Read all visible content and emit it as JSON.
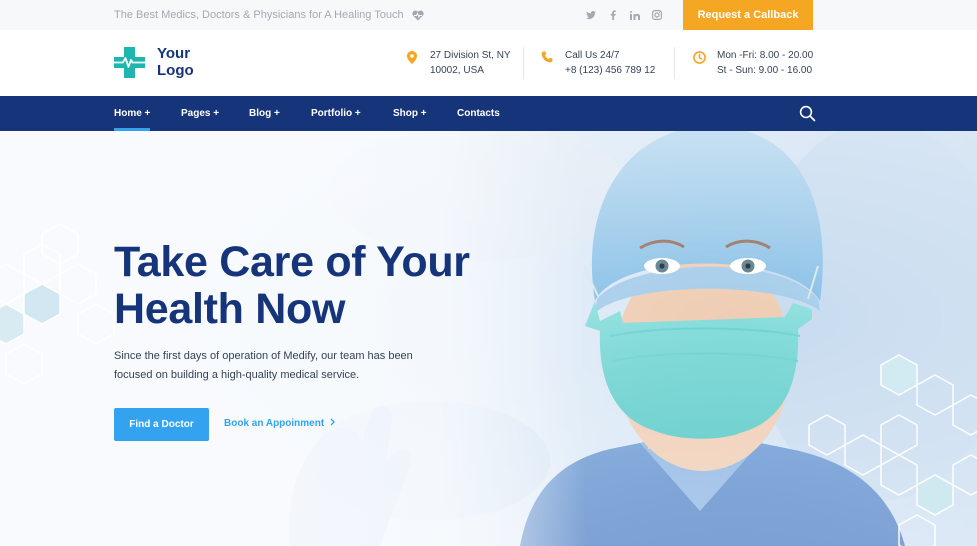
{
  "topbar": {
    "tagline": "The Best Medics, Doctors & Physicians for A Healing Touch",
    "tagline_icon": "heart-pulse-icon",
    "socials": [
      {
        "name": "twitter-icon",
        "glyph": "t"
      },
      {
        "name": "facebook-icon",
        "glyph": "f"
      },
      {
        "name": "linkedin-icon",
        "glyph": "in"
      },
      {
        "name": "instagram-icon",
        "glyph": "◎"
      }
    ],
    "callback_label": "Request a Callback"
  },
  "header": {
    "logo_line1": "Your",
    "logo_line2": "Logo",
    "address": {
      "icon": "location-pin-icon",
      "line1": "27 Division St, NY",
      "line2": "10002, USA"
    },
    "phone": {
      "icon": "phone-icon",
      "line1": "Call Us 24/7",
      "line2": "+8 (123) 456 789 12"
    },
    "hours": {
      "icon": "clock-icon",
      "line1": "Mon -Fri: 8.00 - 20.00",
      "line2": "St - Sun: 9.00 - 16.00"
    }
  },
  "nav": {
    "items": [
      {
        "label": "Home +",
        "active": true
      },
      {
        "label": "Pages +"
      },
      {
        "label": "Blog +"
      },
      {
        "label": "Portfolio +"
      },
      {
        "label": "Shop +"
      },
      {
        "label": "Contacts"
      }
    ],
    "search_icon": "search-icon"
  },
  "hero": {
    "title_line1": "Take Care of Your",
    "title_line2": "Health Now",
    "text_line1": "Since the first days of operation of Medify, our team has been",
    "text_line2": "focused on building a high-quality medical service.",
    "primary_button": "Find a Doctor",
    "secondary_link": "Book an Appoinment",
    "secondary_icon": "chevron-right-icon"
  },
  "colors": {
    "brand_navy": "#16347a",
    "accent_blue": "#33a3f0",
    "accent_orange": "#f5a623",
    "logo_teal": "#1fb5b0"
  }
}
